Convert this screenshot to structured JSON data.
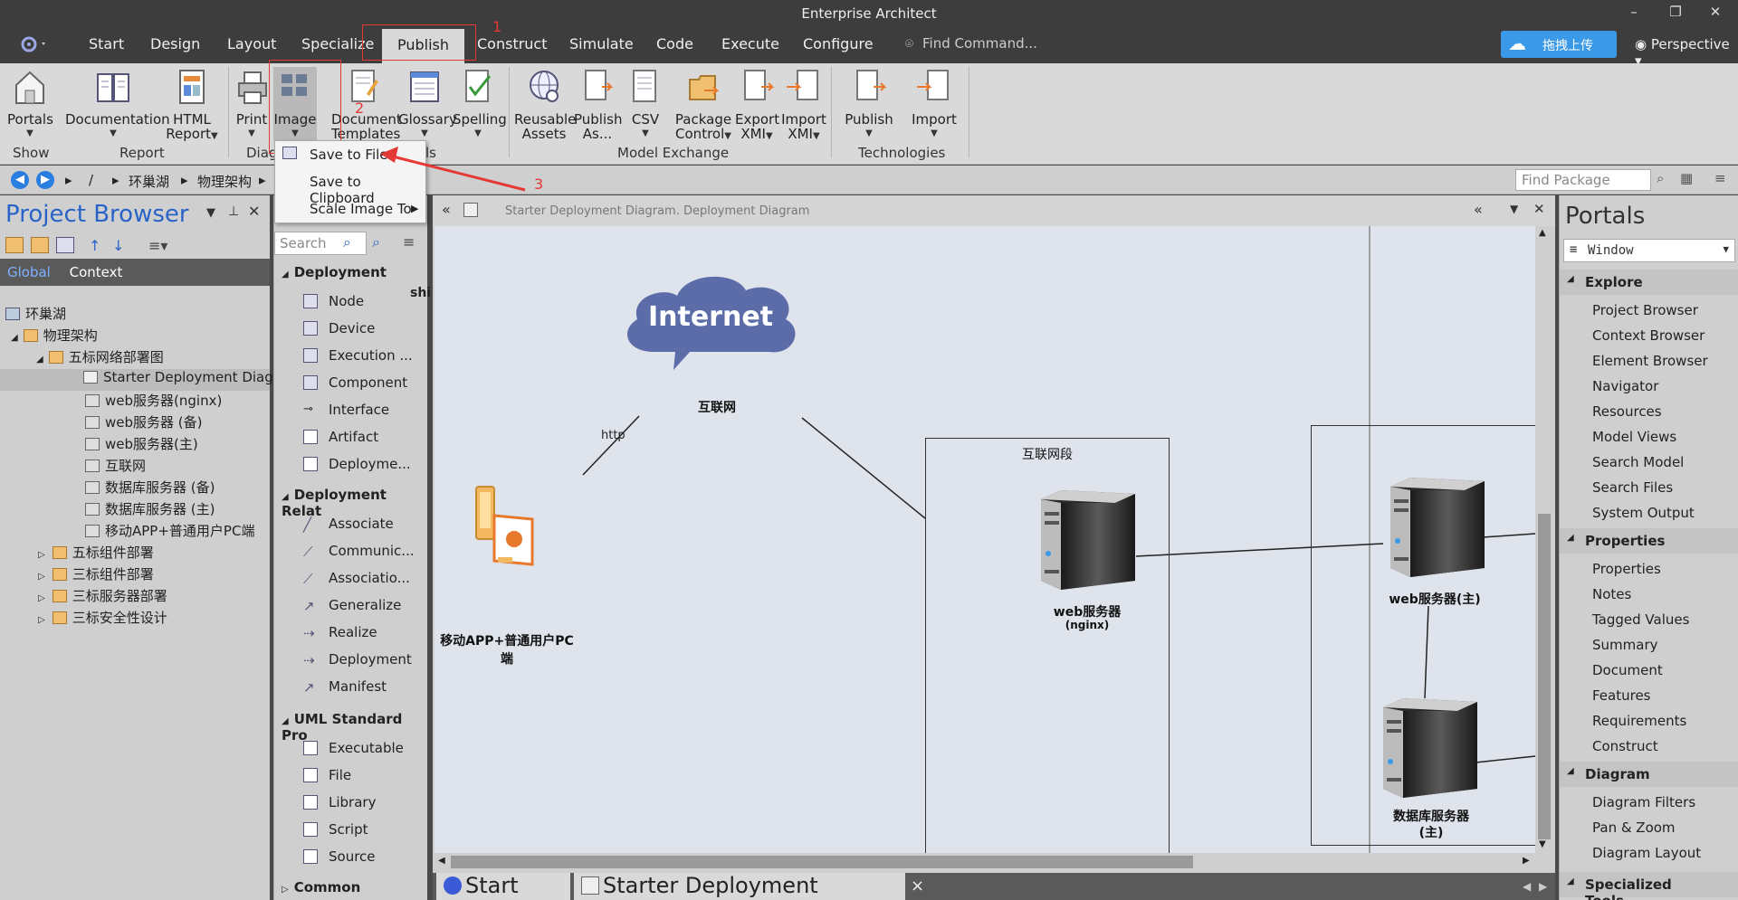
{
  "app": {
    "title": "Enterprise Architect"
  },
  "menu": {
    "items": [
      "Start",
      "Design",
      "Layout",
      "Specialize",
      "Publish",
      "Construct",
      "Simulate",
      "Code",
      "Execute",
      "Configure"
    ],
    "active": "Publish",
    "find_command": "Find Command...",
    "cloud_button": "拖拽上传",
    "perspective": "Perspective"
  },
  "annotations": {
    "n1": "1",
    "n2": "2",
    "n3": "3"
  },
  "ribbon": {
    "buttons": {
      "portals": "Portals",
      "documentation": "Documentation",
      "html_report_1": "HTML",
      "html_report_2": "Report",
      "print": "Print",
      "image": "Image",
      "doc_templates_1": "Document",
      "doc_templates_2": "Templates",
      "glossary": "Glossary",
      "spelling": "Spelling",
      "reusable_1": "Reusable",
      "reusable_2": "Assets",
      "publish_as_1": "Publish",
      "publish_as_2": "As...",
      "csv": "CSV",
      "pkg_control_1": "Package",
      "pkg_control_2": "Control",
      "export_xmi_1": "Export",
      "export_xmi_2": "XMI",
      "import_xmi_1": "Import",
      "import_xmi_2": "XMI",
      "tech_publish": "Publish",
      "tech_import": "Import"
    },
    "groups": {
      "show": "Show",
      "report": "Report",
      "diag": "Diag",
      "ls": "ls",
      "model_exchange": "Model Exchange",
      "technologies": "Technologies"
    }
  },
  "image_menu": {
    "save_to_file": "Save to File",
    "save_to_clipboard": "Save to Clipboard",
    "scale_image_to": "Scale Image To"
  },
  "address": {
    "crumb_root": "/",
    "crumb_1": "环巢湖",
    "crumb_2": "物理架构",
    "find_package": "Find Package"
  },
  "project_browser": {
    "title": "Project Browser",
    "scope_global": "Global",
    "scope_context": "Context",
    "tree": [
      "环巢湖",
      "物理架构",
      "五标网络部署图",
      "Starter Deployment Diag",
      "web服务器(nginx)",
      "web服务器 (备)",
      "web服务器(主)",
      "互联网",
      "数据库服务器 (备)",
      "数据库服务器 (主)",
      "移动APP+普通用户PC端",
      "五标组件部署",
      "三标组件部署",
      "三标服务器部署",
      "三标安全性设计"
    ]
  },
  "toolbox": {
    "search_placeholder": "Search",
    "overflow_text": "shi",
    "sections": {
      "deployment": "Deployment",
      "deployment_rel": "Deployment Relat",
      "uml_standard": "UML Standard Pro",
      "common": "Common"
    },
    "deployment_items": [
      "Node",
      "Device",
      "Execution ...",
      "Component",
      "Interface",
      "Artifact",
      "Deployme..."
    ],
    "relationship_items": [
      "Associate",
      "Communic...",
      "Associatio...",
      "Generalize",
      "Realize",
      "Deployment",
      "Manifest"
    ],
    "uml_items": [
      "Executable",
      "File",
      "Library",
      "Script",
      "Source"
    ]
  },
  "diagram": {
    "path": "Starter Deployment Diagram.  Deployment Diagram",
    "cloud_text": "Internet",
    "internet_label": "互联网",
    "http_label": "http",
    "mobile_label": "移动APP+普通用户PC端",
    "boundary_label": "互联网段",
    "nginx_label_1": "web服务器",
    "nginx_label_2": "(nginx)",
    "web_main_label": "web服务器(主)",
    "db_main_label_1": "数据库服务器",
    "db_main_label_2": "(主)"
  },
  "bottom_tabs": {
    "start_page": "Start Page",
    "deployment_diagram": "Starter Deployment Diagram",
    "close": "×"
  },
  "portals": {
    "title": "Portals",
    "window_select": "Window",
    "sections": {
      "explore": "Explore",
      "properties": "Properties",
      "diagram": "Diagram",
      "specialized": "Specialized Tools"
    },
    "explore_items": [
      "Project Browser",
      "Context Browser",
      "Element Browser",
      "Navigator",
      "Resources",
      "Model Views",
      "Search Model",
      "Search Files",
      "System Output"
    ],
    "properties_items": [
      "Properties",
      "Notes",
      "Tagged Values",
      "Summary",
      "Document",
      "Features",
      "Requirements",
      "Construct"
    ],
    "diagram_items": [
      "Diagram Filters",
      "Pan & Zoom",
      "Diagram Layout"
    ]
  },
  "colors": {
    "accent_blue": "#2a63c8",
    "cloud_fill": "#5b6ca8",
    "annotation_red": "#e53935",
    "upload_button": "#3a9ae8"
  }
}
